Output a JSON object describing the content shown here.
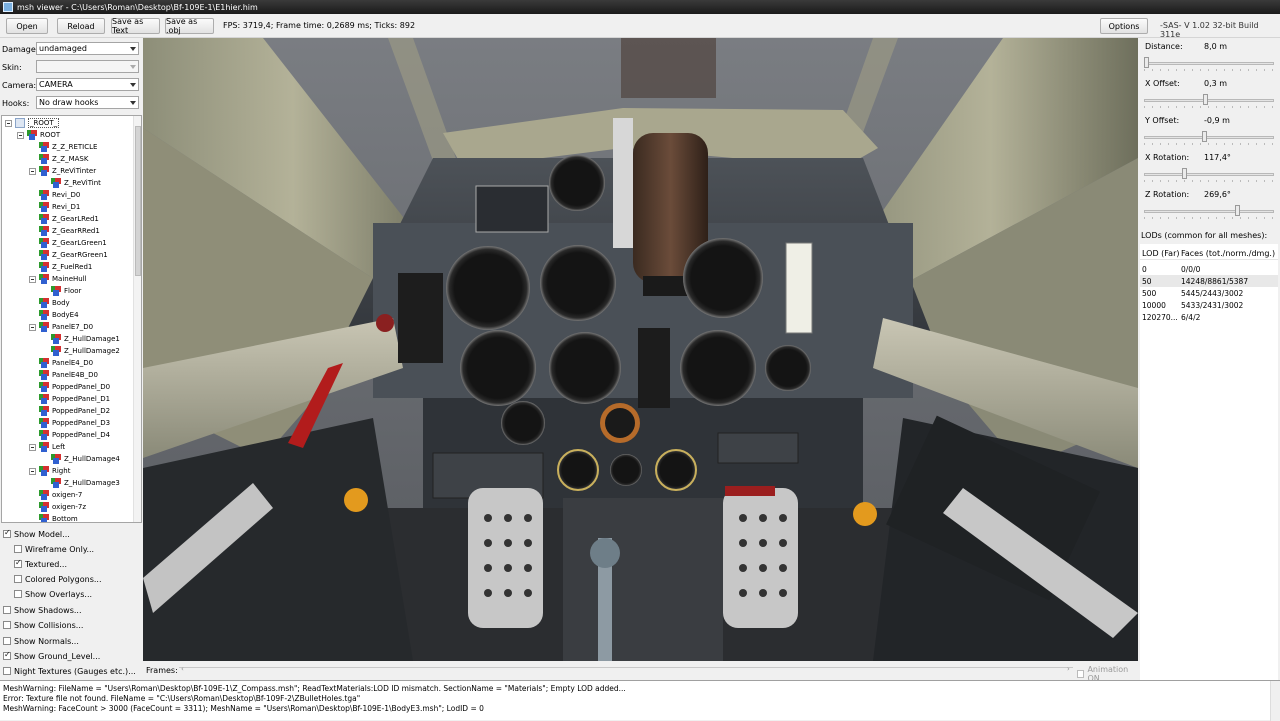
{
  "window": {
    "title": "msh viewer - C:\\Users\\Roman\\Desktop\\Bf-109E-1\\E1hier.him"
  },
  "toolbar": {
    "open_label": "Open",
    "reload_label": "Reload",
    "save_text_label": "Save as Text",
    "save_obj_label": "Save as .obj",
    "fps_text": "FPS: 3719,4; Frame time: 0,2689 ms; Ticks: 892",
    "options_label": "Options",
    "version_text": "-SAS- V 1.02  32-bit  Build 311e"
  },
  "controls": {
    "damage_label": "Damage:",
    "damage_value": "undamaged",
    "skin_label": "Skin:",
    "skin_value": "",
    "camera_label": "Camera:",
    "camera_value": "CAMERA",
    "hooks_label": "Hooks:",
    "hooks_value": "No draw hooks"
  },
  "tree": {
    "nodes": [
      {
        "label": "_ROOT_"
      },
      {
        "label": "ROOT"
      },
      {
        "label": "Z_Z_RETICLE"
      },
      {
        "label": "Z_Z_MASK"
      },
      {
        "label": "Z_ReViTinter"
      },
      {
        "label": "Z_ReViTint"
      },
      {
        "label": "Revi_D0"
      },
      {
        "label": "Revi_D1"
      },
      {
        "label": "Z_GearLRed1"
      },
      {
        "label": "Z_GearRRed1"
      },
      {
        "label": "Z_GearLGreen1"
      },
      {
        "label": "Z_GearRGreen1"
      },
      {
        "label": "Z_FuelRed1"
      },
      {
        "label": "MaineHull"
      },
      {
        "label": "Floor"
      },
      {
        "label": "Body"
      },
      {
        "label": "BodyE4"
      },
      {
        "label": "PanelE7_D0"
      },
      {
        "label": "Z_HullDamage1"
      },
      {
        "label": "Z_HullDamage2"
      },
      {
        "label": "PanelE4_D0"
      },
      {
        "label": "PanelE4B_D0"
      },
      {
        "label": "PoppedPanel_D0"
      },
      {
        "label": "PoppedPanel_D1"
      },
      {
        "label": "PoppedPanel_D2"
      },
      {
        "label": "PoppedPanel_D3"
      },
      {
        "label": "PoppedPanel_D4"
      },
      {
        "label": "Left"
      },
      {
        "label": "Z_HullDamage4"
      },
      {
        "label": "Right"
      },
      {
        "label": "Z_HullDamage3"
      },
      {
        "label": "oxigen-7"
      },
      {
        "label": "oxigen-7z"
      },
      {
        "label": "Bottom"
      }
    ]
  },
  "options": {
    "show_model": "Show Model...",
    "wireframe": "Wireframe Only...",
    "textured": "Textured...",
    "colored_polygons": "Colored Polygons...",
    "show_overlays": "Show Overlays...",
    "show_shadows": "Show Shadows...",
    "show_collisions": "Show Collisions...",
    "show_normals": "Show Normals...",
    "show_ground": "Show Ground_Level...",
    "night_textures": "Night Textures (Gauges etc.)..."
  },
  "frames": {
    "label": "Frames:",
    "animation_label": "Animation ON"
  },
  "sliders": {
    "distance_label": "Distance:",
    "distance_value": "8,0 m",
    "distance_level": 0.0,
    "xoffset_label": "X Offset:",
    "xoffset_value": "0,3 m",
    "xoffset_level": 0.47,
    "yoffset_label": "Y Offset:",
    "yoffset_value": "-0,9 m",
    "yoffset_level": 0.46,
    "xrot_label": "X Rotation:",
    "xrot_value": "117,4°",
    "xrot_level": 0.3,
    "zrot_label": "Z Rotation:",
    "zrot_value": "269,6°",
    "zrot_level": 0.73
  },
  "lod": {
    "title": "LODs (common for all meshes):",
    "header_lod": "LOD (Far)",
    "header_faces": "Faces (tot./norm./dmg.)",
    "rows": [
      {
        "lod": "0",
        "faces": "0/0/0"
      },
      {
        "lod": "50",
        "faces": "14248/8861/5387"
      },
      {
        "lod": "500",
        "faces": "5445/2443/3002"
      },
      {
        "lod": "10000",
        "faces": "5433/2431/3002"
      },
      {
        "lod": "120270...",
        "faces": "6/4/2"
      }
    ]
  },
  "log": {
    "line1": "MeshWarning: FileName = \"Users\\Roman\\Desktop\\Bf-109E-1\\Z_Compass.msh\"; ReadTextMaterials:LOD ID mismatch. SectionName = \"Materials\"; Empty LOD added...",
    "line2": "Error: Texture file not found. FileName = \"C:\\Users\\Roman\\Desktop\\Bf-109F-2\\ZBulletHoles.tga\"",
    "line3": "MeshWarning: FaceCount > 3000 (FaceCount = 3311); MeshName = \"Users\\Roman\\Desktop\\Bf-109E-1\\BodyE3.msh\"; LodID = 0"
  },
  "colors": {
    "viewport_bg": "#5d6066",
    "panel_bg": "#f0f0f0"
  }
}
